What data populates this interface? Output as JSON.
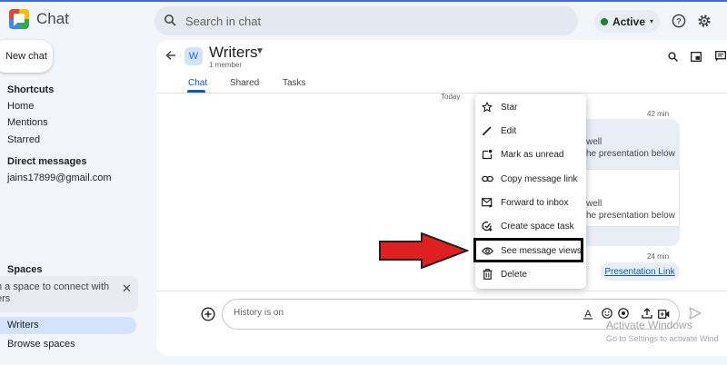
{
  "app": {
    "title": "Chat"
  },
  "search": {
    "placeholder": "Search in chat"
  },
  "status": {
    "label": "Active",
    "color": "#188038"
  },
  "header_icons": [
    "help-icon",
    "gear-icon"
  ],
  "sidebar": {
    "new_chat": "New chat",
    "shortcuts_heading": "Shortcuts",
    "shortcuts": [
      "Home",
      "Mentions",
      "Starred"
    ],
    "dm_heading": "Direct messages",
    "dms": [
      "jains17899@gmail.com"
    ],
    "spaces_heading": "Spaces",
    "banner_line1": "n a space to connect with",
    "banner_line2": "ers",
    "spaces": [
      "Writers",
      "Browse spaces"
    ]
  },
  "space": {
    "avatar_letter": "W",
    "title": "Writers",
    "members": "1 member",
    "tabs": [
      "Chat",
      "Shared",
      "Tasks"
    ],
    "active_tab": "Chat"
  },
  "thread": {
    "day_label": "Today",
    "msg1_time": "42 min",
    "msg1_line1": "well",
    "msg1_line2": "he presentation below",
    "msg1_line3": "well",
    "msg1_line4": "he presentation below",
    "msg2_time": "24 min",
    "msg2_link": "Presentation Link"
  },
  "context_menu": {
    "items": [
      {
        "label": "Star",
        "icon": "star-icon"
      },
      {
        "label": "Edit",
        "icon": "pencil-icon"
      },
      {
        "label": "Mark as unread",
        "icon": "mark-unread-icon"
      },
      {
        "label": "Copy message link",
        "icon": "link-icon"
      },
      {
        "label": "Forward to inbox",
        "icon": "forward-mail-icon"
      },
      {
        "label": "Create space task",
        "icon": "add-task-icon"
      },
      {
        "label": "See message views",
        "icon": "eye-icon"
      },
      {
        "label": "Delete",
        "icon": "trash-icon"
      }
    ],
    "highlighted": "See message views"
  },
  "annotation": {
    "arrow_color": "#e02020"
  },
  "composer": {
    "placeholder": "History is on"
  },
  "watermark": {
    "line1": "Activate Windows",
    "line2": "Go to Settings to activate Wind"
  }
}
